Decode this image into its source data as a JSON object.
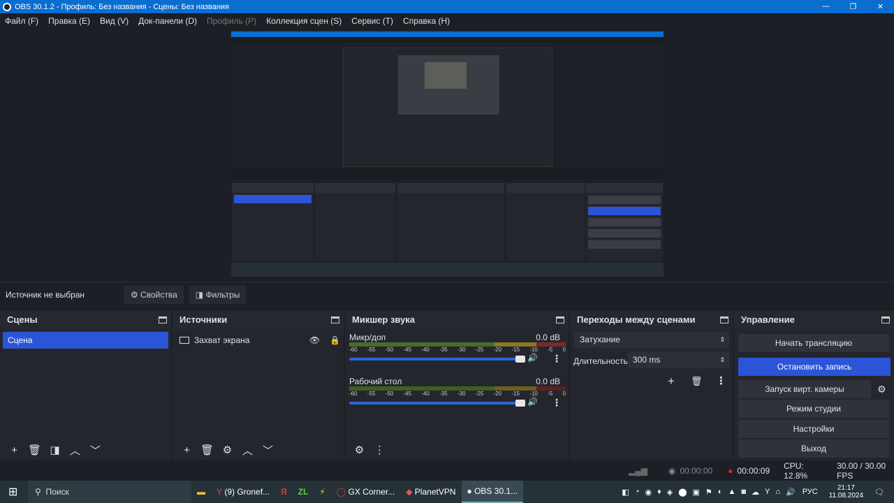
{
  "window": {
    "title": "OBS 30.1.2 - Профиль: Без названия - Сцены: Без названия",
    "minimize": "—",
    "maximize": "❐",
    "close": "✕"
  },
  "menu": [
    "Файл (F)",
    "Правка (E)",
    "Вид (V)",
    "Док-панели (D)",
    "Профиль (P)",
    "Коллекция сцен (S)",
    "Сервис (T)",
    "Справка (H)"
  ],
  "source_bar": {
    "label": "Источник не выбран",
    "properties": "Свойства",
    "filters": "Фильтры"
  },
  "scenes": {
    "title": "Сцены",
    "items": [
      "Сцена"
    ]
  },
  "sources": {
    "title": "Источники",
    "items": [
      "Захват экрана"
    ]
  },
  "mixer": {
    "title": "Микшер звука",
    "channels": [
      {
        "name": "Микр/доп",
        "db": "0.0 dB"
      },
      {
        "name": "Рабочий стол",
        "db": "0.0 dB"
      }
    ],
    "scale": [
      "-60",
      "-55",
      "-50",
      "-45",
      "-40",
      "-35",
      "-30",
      "-25",
      "-20",
      "-15",
      "-10",
      "-5",
      "0"
    ]
  },
  "transitions": {
    "title": "Переходы между сценами",
    "type": "Затухание",
    "duration_label": "Длительность",
    "duration": "300 ms"
  },
  "controls": {
    "title": "Управление",
    "start_stream": "Начать трансляцию",
    "stop_record": "Остановить запись",
    "virtual_cam": "Запуск вирт. камеры",
    "studio_mode": "Режим студии",
    "settings": "Настройки",
    "exit": "Выход"
  },
  "status": {
    "stream_time": "00:00:00",
    "record_time": "00:00:09",
    "cpu": "CPU: 12.8%",
    "fps": "30.00 / 30.00 FPS"
  },
  "taskbar": {
    "search": "Поиск",
    "apps": [
      "(9) Gronef...",
      "GX Corner...",
      "PlanetVPN",
      "OBS 30.1..."
    ],
    "lang": "РУС",
    "time": "21:17",
    "date": "11.08.2024"
  }
}
